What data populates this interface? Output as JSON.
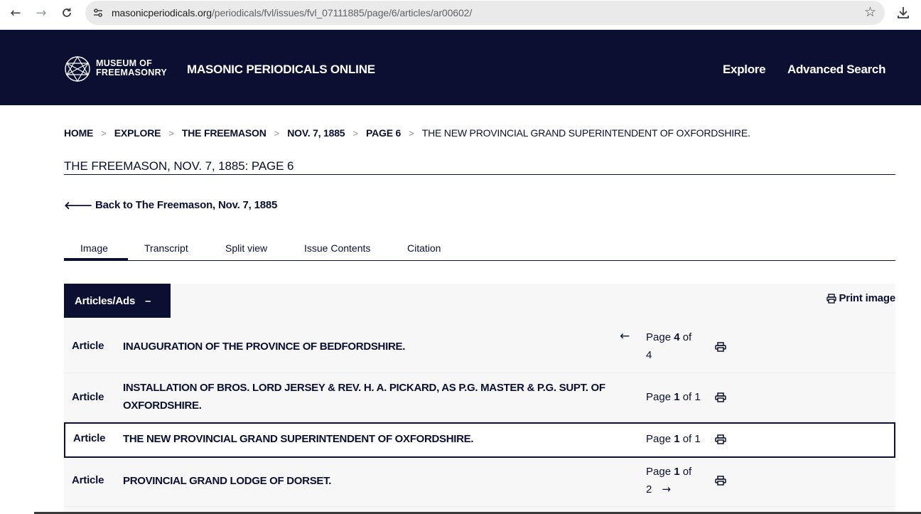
{
  "browser": {
    "url_host": "masonicperiodicals.org",
    "url_path": "/periodicals/fvl/issues/fvl_07111885/page/6/articles/ar00602/",
    "back_icon": "arrow-left-icon",
    "forward_icon": "arrow-right-icon",
    "reload_icon": "reload-icon",
    "bookmark_icon": "star-icon",
    "download_icon": "download-icon"
  },
  "header": {
    "logo_line1": "MUSEUM OF",
    "logo_line2": "FREEMASONRY",
    "site_title": "MASONIC PERIODICALS ONLINE",
    "nav": [
      "Explore",
      "Advanced Search"
    ],
    "bg_color": "#0b1033"
  },
  "breadcrumb": [
    "HOME",
    "EXPLORE",
    "THE FREEMASON",
    "NOV. 7, 1885",
    "PAGE 6",
    "THE NEW PROVINCIAL GRAND SUPERINTENDENT OF OXFORDSHIRE."
  ],
  "breadcrumb_separator": ">",
  "page_heading": "THE FREEMASON, NOV. 7, 1885: PAGE 6",
  "back_link": "Back to The Freemason, Nov. 7, 1885",
  "tabs": [
    "Image",
    "Transcript",
    "Split view",
    "Issue Contents",
    "Citation"
  ],
  "active_tab": "Image",
  "panel": {
    "toggle_label": "Articles/Ads",
    "toggle_symbol": "–",
    "print_image_label": "Print image"
  },
  "articles": [
    {
      "type": "Article",
      "title": "INAUGURATION OF THE PROVINCE OF BEDFORDSHIRE.",
      "page_prefix": "Page ",
      "page_num": "4",
      "page_suffix": " of",
      "page_total": "4",
      "prev": "←",
      "next": ""
    },
    {
      "type": "Article",
      "title": "INSTALLATION OF BROS. LORD JERSEY & REV. H. A. PICKARD, AS P.G. MASTER & P.G. SUPT. OF OXFORDSHIRE.",
      "page_prefix": "Page ",
      "page_num": "1",
      "page_suffix": " of 1",
      "page_total": "",
      "prev": "",
      "next": ""
    },
    {
      "type": "Article",
      "title": "THE NEW PROVINCIAL GRAND SUPERINTENDENT OF OXFORDSHIRE.",
      "page_prefix": "Page ",
      "page_num": "1",
      "page_suffix": " of 1",
      "page_total": "",
      "prev": "",
      "next": "",
      "current": true
    },
    {
      "type": "Article",
      "title": "PROVINCIAL GRAND LODGE OF DORSET.",
      "page_prefix": "Page ",
      "page_num": "1",
      "page_suffix": " of",
      "page_total": "2",
      "prev": "",
      "next": "→"
    }
  ]
}
